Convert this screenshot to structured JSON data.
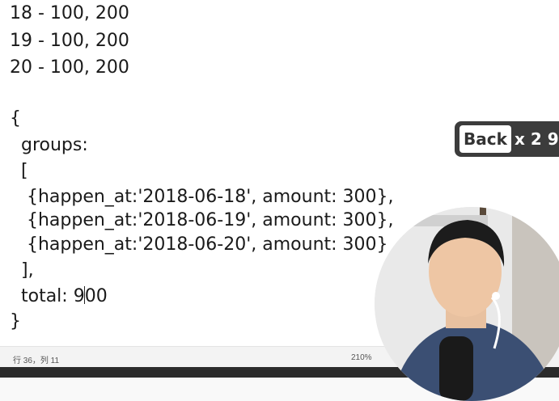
{
  "editor": {
    "lines": [
      "18 - 100, 200",
      "19 - 100, 200",
      "20 - 100, 200",
      "",
      "{",
      "  groups:",
      "  [",
      "   {happen_at:'2018-06-18', amount: 300},",
      "   {happen_at:'2018-06-19', amount: 300},",
      "   {happen_at:'2018-06-20', amount: 300}",
      "  ],",
      "  total: 9",
      "}"
    ],
    "caret_after": "00"
  },
  "status_bar": {
    "position": "行 36，列 11",
    "zoom": "210%"
  },
  "overlay": {
    "back_label": "Back",
    "multiplier": "x 2 9"
  },
  "colors": {
    "overlay_bg": "#3c3c3c",
    "shirt": "#3b4f73"
  }
}
